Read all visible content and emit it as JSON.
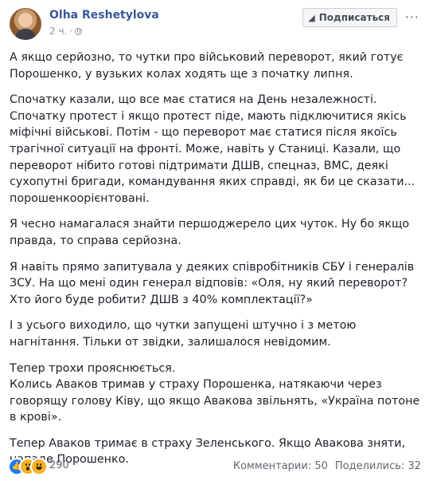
{
  "post": {
    "author": "Olha Reshetylova",
    "time": "2 ч.",
    "privacy_icon": "globe-icon",
    "follow_label": "Подписаться",
    "more_icon": "···",
    "paragraphs": [
      "А якщо серйозно, то чутки про військовий переворот, який готує Порошенко, у вузьких колах ходять ще з початку липня.",
      "Спочатку казали, що все має статися на День незалежності.\nСпочатку протест і якщо протест піде, мають підключитися якісь міфічні військові. Потім - що переворот має статися після якоїсь трагічної ситуації на фронті. Може, навіть у Станиці. Казали, що переворот нібито готові підтримати ДШВ, спецназ, ВМС, деякі сухопутні бригади, командування яких справді, як би це сказати... порошенкоорієнтовані.",
      "Я чесно намагалася знайти першоджерело цих чуток. Ну бо якщо правда, то справа серйозна.",
      "Я навіть прямо запитувала у деяких співробітників СБУ і генералів ЗСУ. На що мені один генерал відповів: «Оля, ну який переворот? Хто його буде робити? ДШВ з 40% комплектації?»",
      "І з усього виходило, що чутки запущені штучно і з метою нагнітання. Тільки от звідки, залишалося невідомим.",
      "Тепер трохи прояснюється.\nКолись Аваков тримав у страху Порошенка, натякаючи через говорящу голову Ківу, що якщо Авакова звільнять, «Україна потоне в крові».",
      "Тепер Аваков тримає в страху Зеленського. Якщо Авакова зняти, нападе Порошенко."
    ],
    "reactions_count": "290",
    "comments": "Комментарии: 50",
    "shares": "Поделились: 32",
    "colors": {
      "link": "#385898",
      "like_blue": "#2078f4",
      "emoji_yellow": "#f7b125"
    }
  }
}
